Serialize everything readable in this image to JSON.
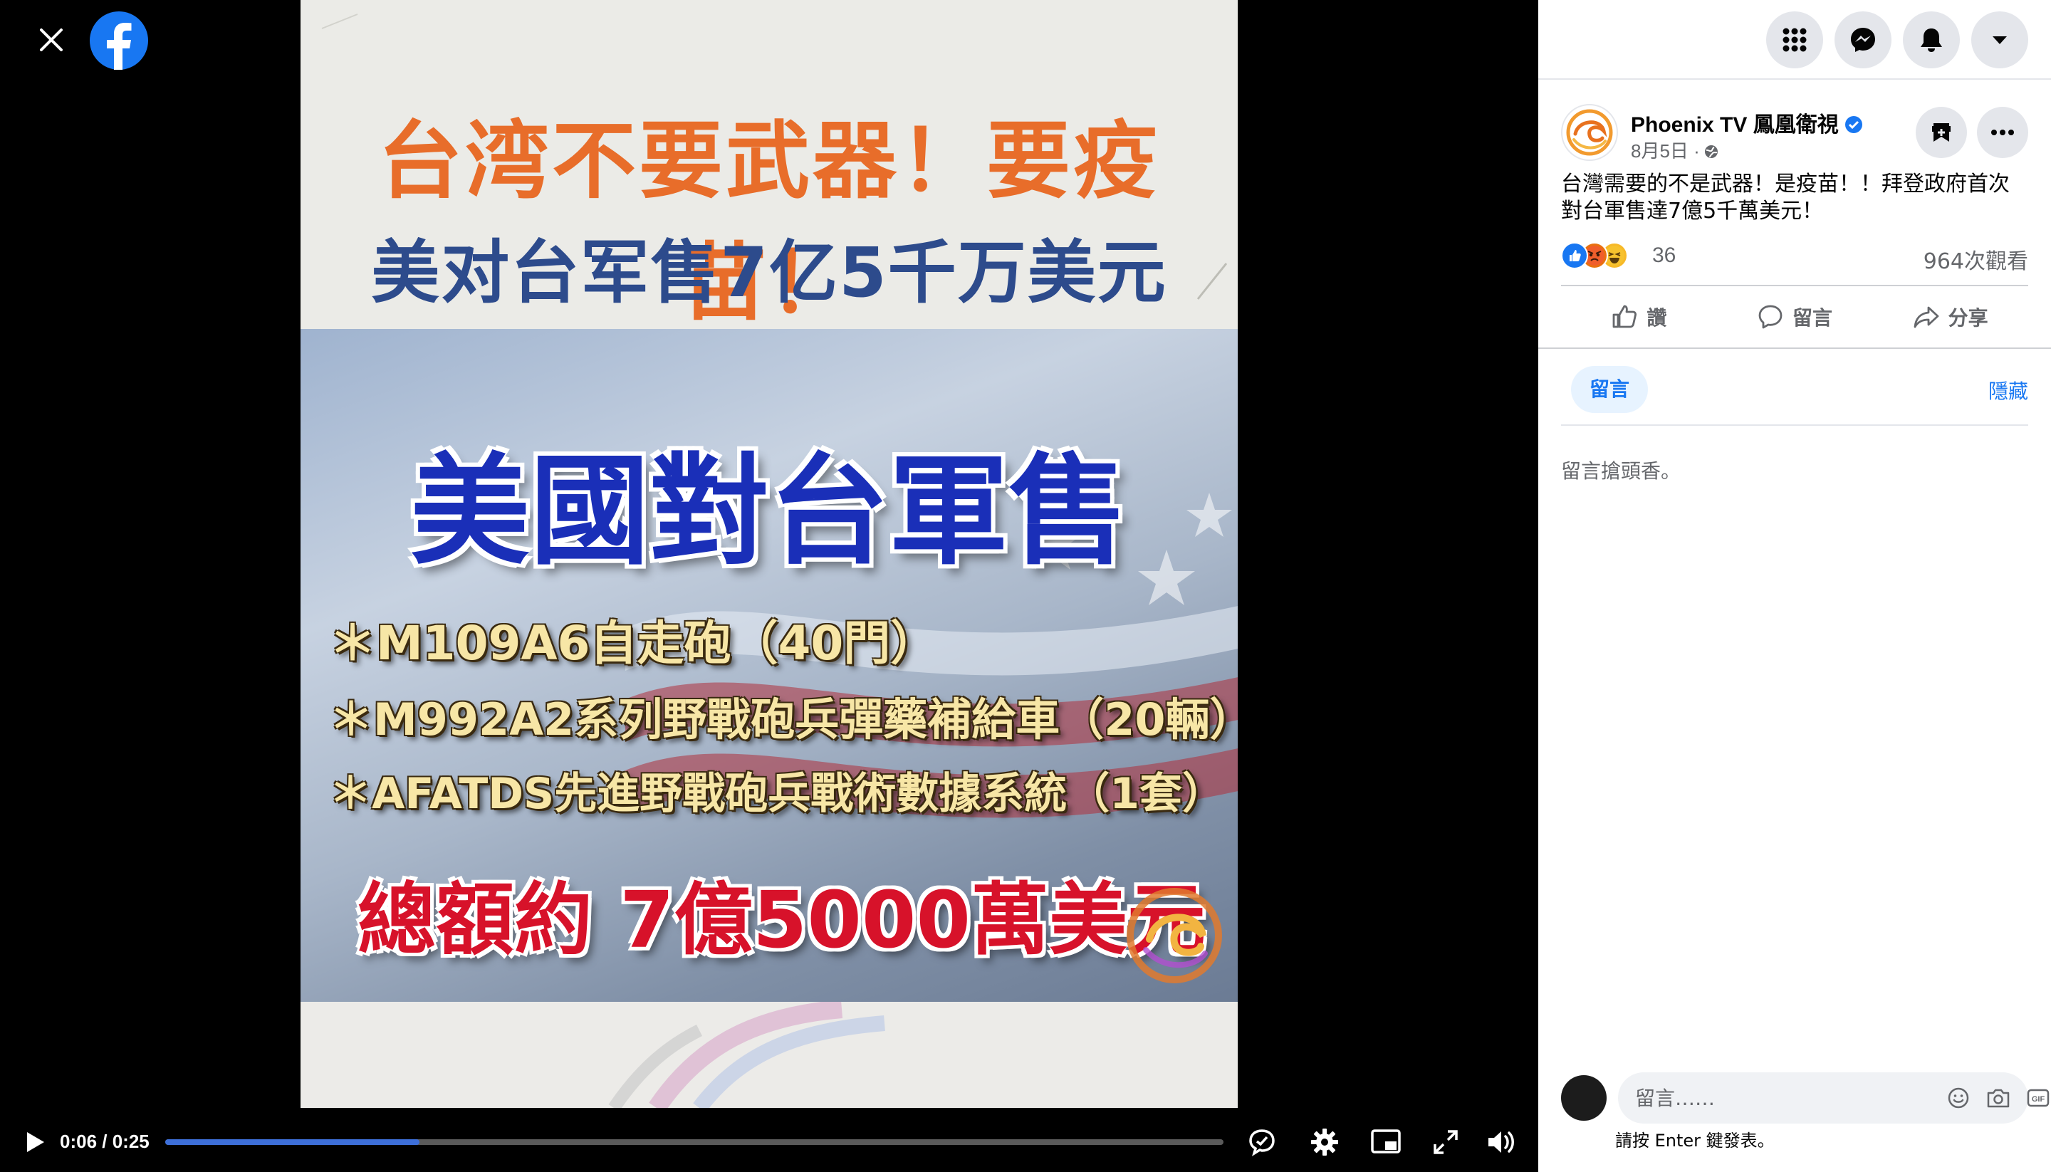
{
  "video": {
    "headline_1": "台湾不要武器！要疫苗！",
    "headline_2": "美对台军售7亿5千万美元",
    "panel_title": "美國對台軍售",
    "panel_lines": [
      "＊M109A6自走砲（40門）",
      "＊M992A2系列野戰砲兵彈藥補給車（20輛）",
      "＊AFATDS先進野戰砲兵戰術數據系統（1套）"
    ],
    "panel_total": "總額約 7億5000萬美元"
  },
  "controls": {
    "time": "0:06 / 0:25",
    "progress_fraction": 0.24
  },
  "topbar_icons": [
    "menu-grid-icon",
    "messenger-icon",
    "bell-icon",
    "caret-down-icon"
  ],
  "post": {
    "page_name": "Phoenix TV 鳳凰衛視",
    "date": "8月5日 ·",
    "text": "台灣需要的不是武器！是疫苗！！拜登政府首次對台軍售達7億5千萬美元！",
    "reaction_count": "36",
    "view_count": "964次觀看",
    "actions": {
      "like": "讚",
      "comment": "留言",
      "share": "分享"
    }
  },
  "comments": {
    "tab_label": "留言",
    "hide_label": "隱藏",
    "empty_text": "留言搶頭香。",
    "input_placeholder": "留言……",
    "enter_hint": "請按 Enter 鍵發表。"
  },
  "colors": {
    "facebook_blue": "#1877f2",
    "progress_blue": "#3d6fd9",
    "headline_orange": "#e86d2a",
    "headline_blue": "#2d4b8c"
  }
}
